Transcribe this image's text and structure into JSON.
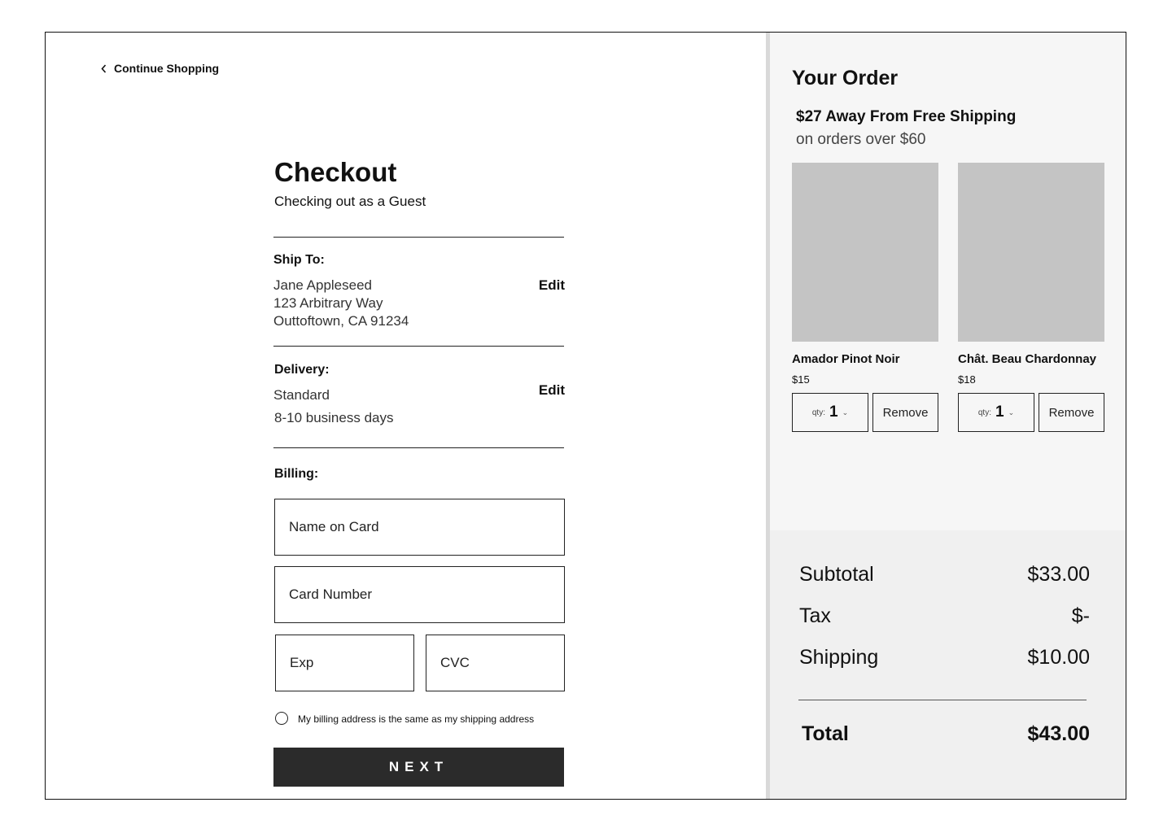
{
  "nav": {
    "back_label": "Continue Shopping"
  },
  "checkout": {
    "title": "Checkout",
    "subtitle": "Checking out as a Guest",
    "ship_to": {
      "heading": "Ship To:",
      "name": "Jane Appleseed",
      "street": "123 Arbitrary Way",
      "city": "Outtoftown, CA 91234",
      "edit_label": "Edit"
    },
    "delivery": {
      "heading": "Delivery:",
      "method": "Standard",
      "eta": "8-10 business days",
      "edit_label": "Edit"
    },
    "billing": {
      "heading": "Billing:",
      "name_placeholder": "Name on Card",
      "card_placeholder": "Card Number",
      "exp_placeholder": "Exp",
      "cvc_placeholder": "CVC",
      "same_address_label": "My billing address is the same as my shipping address"
    },
    "next_label": "NEXT"
  },
  "order": {
    "title": "Your Order",
    "free_shipping_msg": "$27 Away From Free Shipping",
    "free_shipping_sub": "on orders over $60",
    "items": [
      {
        "name": "Amador Pinot Noir",
        "price": "$15",
        "qty_label": "qty:",
        "qty": "1",
        "remove_label": "Remove"
      },
      {
        "name": "Chât. Beau Chardonnay",
        "price": "$18",
        "qty_label": "qty:",
        "qty": "1",
        "remove_label": "Remove"
      }
    ]
  },
  "summary": {
    "subtotal_label": "Subtotal",
    "subtotal_value": "$33.00",
    "tax_label": "Tax",
    "tax_value": "$-",
    "shipping_label": "Shipping",
    "shipping_value": "$10.00",
    "total_label": "Total",
    "total_value": "$43.00"
  },
  "colors": {
    "button_dark": "#2b2b2b",
    "order_panel_bg": "#f6f6f6",
    "summary_panel_bg": "#f0f0f0",
    "image_placeholder": "#c4c4c4",
    "divider": "#d9d9d9"
  },
  "icons": {
    "back": "chevron-left-icon",
    "qty_toggle": "chevron-down-icon",
    "radio": "radio-unchecked-icon"
  }
}
